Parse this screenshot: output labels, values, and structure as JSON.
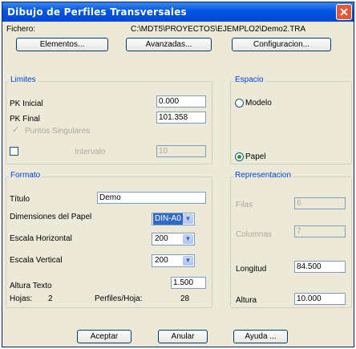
{
  "window": {
    "title": "Dibujo de Perfiles Transversales",
    "close_glyph": "✕"
  },
  "fichero": {
    "label": "Fichero:",
    "path": "C:\\MDT5\\PROYECTOS\\EJEMPLO2\\Demo2.TRA"
  },
  "top_buttons": {
    "elementos": "Elementos...",
    "avanzadas": "Avanzadas...",
    "configuracion": "Configuracion..."
  },
  "limites": {
    "title": "Limites",
    "pk_inicial_label": "PK Inicial",
    "pk_inicial": "0.000",
    "pk_final_label": "PK Final",
    "pk_final": "101.358",
    "puntos_singulares": "Puntos Singulares",
    "intervalo_label": "Intervalo",
    "intervalo": "10"
  },
  "espacio": {
    "title": "Espacio",
    "modelo": "Modelo",
    "papel": "Papel",
    "selected": "papel"
  },
  "formato": {
    "title": "Formato",
    "titulo_label": "Título",
    "titulo": "Demo",
    "dimensiones_label": "Dimensiones del Papel",
    "dimensiones": "DIN-A0",
    "escala_h_label": "Escala Horizontal",
    "escala_h": "200",
    "escala_v_label": "Escala Vertical",
    "escala_v": "200",
    "altura_texto_label": "Altura Texto",
    "altura_texto": "1.500",
    "hojas_label": "Hojas:",
    "hojas": "2",
    "perfiles_hoja_label": "Perfiles/Hoja:",
    "perfiles_hoja": "28"
  },
  "representacion": {
    "title": "Representacion",
    "filas_label": "Filas",
    "filas": "6",
    "columnas_label": "Columnas",
    "columnas": "7",
    "longitud_label": "Longitud",
    "longitud": "84.500",
    "altura_label": "Altura",
    "altura": "10.000"
  },
  "bottom_buttons": {
    "aceptar": "Aceptar",
    "anular": "Anular",
    "ayuda": "Ayuda ..."
  }
}
